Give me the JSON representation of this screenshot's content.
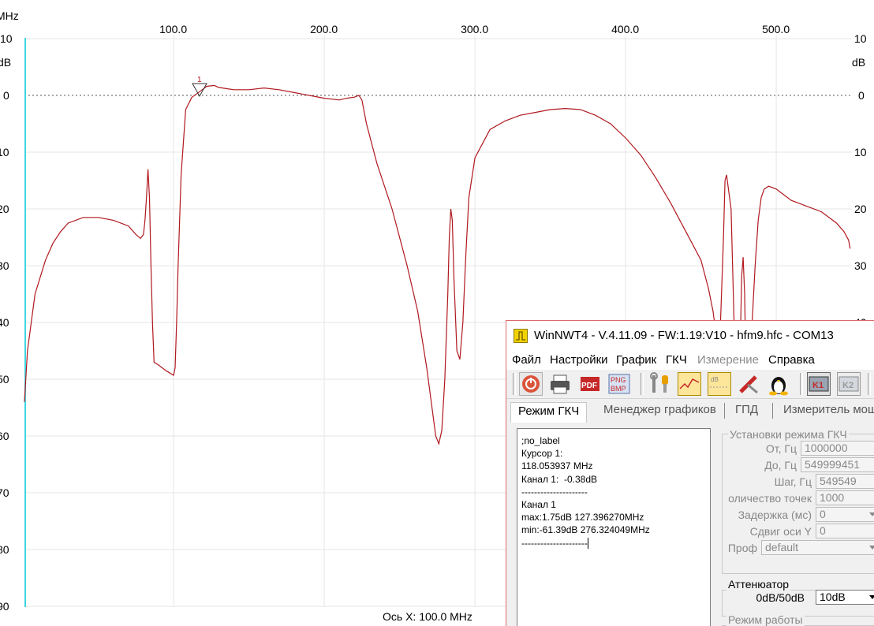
{
  "graph": {
    "freq_unit": "MHz",
    "top_labels": [
      "100.0",
      "200.0",
      "300.0",
      "400.0",
      "500.0"
    ],
    "db_unit": "dB",
    "y_labels": [
      "10",
      "0",
      "10",
      "20",
      "30",
      "40",
      "50",
      "60",
      "70",
      "80",
      "90"
    ],
    "right_labels": [
      "10",
      "0",
      "10",
      "20",
      "30",
      "40"
    ],
    "x_axis_caption": "Ось X: 100.0 MHz",
    "marker_label": "1",
    "trace_color": "#b0181e",
    "start_line_color": "#3fd6e0"
  },
  "window": {
    "title": "WinNWT4 - V.4.11.09 - FW:1.19:V10 - hfm9.hfc - COM13",
    "menu": [
      "Файл",
      "Настройки",
      "График",
      "ГКЧ",
      "Измерение",
      "Справка"
    ],
    "toolbar_icons": [
      "power-icon",
      "printer-icon",
      "pdf-icon",
      "png-bmp-icon",
      "tools-icon",
      "chart-icon",
      "db-chart-icon",
      "probe-icon",
      "linux-icon",
      "k1-icon",
      "k2-icon"
    ],
    "pdf_text": "PDF",
    "png_text": "PNG",
    "bmp_text": "BMP",
    "db_icon_text": "dB",
    "k1_text": "K1",
    "k2_text": "K2",
    "tabs": [
      "Режим ГКЧ",
      "Менеджер графиков",
      "ГПД",
      "Измеритель мощ"
    ],
    "info_lines": [
      ";no_label",
      "",
      "Курсор 1:",
      "118.053937 MHz",
      "Канал 1:  -0.38dB",
      "---------------------",
      "Канал 1",
      "max:1.75dB 127.396270MHz",
      "min:-61.39dB 276.324049MHz",
      "---------------------"
    ],
    "settings": {
      "legend": "Установки режима ГКЧ",
      "from_label": "От, Гц",
      "from_value": "1000000",
      "to_label": "До, Гц",
      "to_value": "549999451",
      "step_label": "Шаг, Гц",
      "step_value": "549549",
      "points_label": "оличество точек",
      "points_value": "1000",
      "delay_label": "Задержка (мс)",
      "delay_value": "0",
      "shift_label": "Сдвиг оси Y",
      "shift_value": "0",
      "profile_label": "Проф",
      "profile_value": "default"
    },
    "attenuator": {
      "legend": "Аттенюатор",
      "range_label": "0dB/50dB",
      "value": "10dB"
    },
    "mode_legend": "Режим работы"
  },
  "chart_data": {
    "type": "line",
    "xlabel": "Ось X: 100.0 MHz",
    "xlim": [
      1.0,
      549.9
    ],
    "ylim": [
      -90,
      10
    ],
    "x_ticks": [
      100,
      200,
      300,
      400,
      500
    ],
    "y_ticks": [
      10,
      0,
      -10,
      -20,
      -30,
      -40,
      -50,
      -60,
      -70,
      -80,
      -90
    ],
    "series": [
      {
        "x": [
          1,
          3,
          8,
          15,
          20,
          25,
          30,
          40,
          50,
          60,
          70,
          75,
          78,
          80,
          81,
          82,
          83,
          84,
          85,
          86,
          87,
          90,
          95,
          100,
          101,
          102,
          103,
          105,
          108,
          112,
          118,
          122,
          127,
          130,
          135,
          140,
          150,
          160,
          170,
          180,
          190,
          200,
          210,
          215,
          220,
          223,
          225,
          228,
          235,
          245,
          255,
          262,
          268,
          272,
          274,
          276,
          278,
          280,
          282,
          283,
          284,
          285,
          286,
          288,
          290,
          292,
          294,
          296,
          300,
          310,
          320,
          330,
          340,
          350,
          360,
          370,
          380,
          390,
          400,
          410,
          420,
          430,
          440,
          450,
          455,
          458,
          460,
          462,
          463,
          465,
          466,
          467,
          470,
          472,
          474,
          476,
          477,
          478,
          479,
          480,
          482,
          484,
          486,
          488,
          490,
          492,
          495,
          500,
          505,
          510,
          520,
          530,
          540,
          545,
          548,
          549
        ],
        "y": [
          -54,
          -45,
          -35,
          -29,
          -26,
          -24,
          -22.5,
          -21.5,
          -21.5,
          -22,
          -23,
          -24.5,
          -25.2,
          -24.5,
          -22,
          -18,
          -13,
          -18,
          -30,
          -40,
          -47,
          -47.5,
          -48.5,
          -49.3,
          -48,
          -40,
          -30,
          -14,
          -2.5,
          -0.38,
          0.8,
          1.6,
          1.75,
          1.4,
          1.2,
          1.0,
          1.0,
          1.3,
          1.0,
          0.5,
          0,
          -0.5,
          -0.8,
          -0.5,
          -0.3,
          0,
          -0.8,
          -5,
          -12,
          -20,
          -30,
          -38,
          -48,
          -56,
          -60,
          -61.39,
          -59,
          -50,
          -35,
          -25,
          -20,
          -22,
          -32,
          -45,
          -46.5,
          -40,
          -28,
          -18,
          -11,
          -6,
          -4.5,
          -3.5,
          -3,
          -2.5,
          -2.3,
          -2.5,
          -3.5,
          -5,
          -7.5,
          -10.5,
          -14.5,
          -19,
          -24,
          -29,
          -34,
          -38,
          -42,
          -45,
          -40,
          -25,
          -15,
          -14,
          -20,
          -40,
          -55,
          -45,
          -32,
          -28.5,
          -35,
          -50,
          -54,
          -40,
          -30,
          -22,
          -18,
          -16.5,
          -16,
          -16.5,
          -17.5,
          -18.5,
          -19.5,
          -20.5,
          -22.5,
          -24,
          -25.5,
          -27
        ]
      }
    ]
  }
}
